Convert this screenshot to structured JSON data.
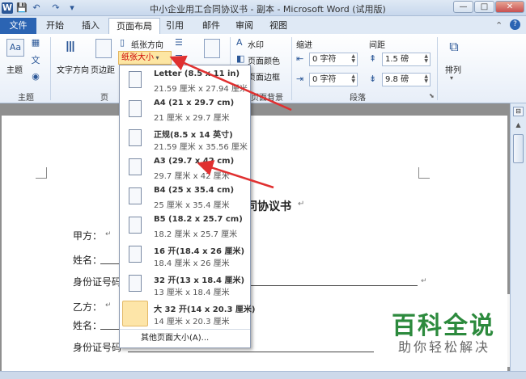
{
  "window": {
    "logo": "W",
    "title": "中小企业用工合同协议书 - 副本 - Microsoft Word (试用版)",
    "controls": {
      "minimize": "—",
      "maximize": "□",
      "close": "✕"
    }
  },
  "tabs": [
    "文件",
    "开始",
    "插入",
    "页面布局",
    "引用",
    "邮件",
    "审阅",
    "视图"
  ],
  "ribbon": {
    "theme_group": {
      "label": "主题",
      "button": "主题"
    },
    "page_setup": {
      "orientation": "纸张方向",
      "paper_size": "纸张大小",
      "text_direction": "文字方向",
      "margins": "页边距",
      "group_label": "页",
      "partial_text": "稿纸"
    },
    "page_bg": {
      "watermark": "水印",
      "page_color": "页面颜色",
      "page_border": "页面边框",
      "group_label": "页面背景"
    },
    "paragraph": {
      "indent_label": "缩进",
      "spacing_label": "间距",
      "indent_left": "0 字符",
      "indent_right": "0 字符",
      "spacing_before": "1.5 磅",
      "spacing_after": "9.8 磅",
      "group_label": "段落"
    },
    "arrange": {
      "label": "排列"
    }
  },
  "paper_sizes": [
    {
      "title": "Letter (8.5 x 11 in)",
      "dims": "21.59 厘米 x 27.94 厘米"
    },
    {
      "title": "A4 (21 x 29.7 cm)",
      "dims": "21 厘米 x 29.7 厘米"
    },
    {
      "title": "正规(8.5 x 14 英寸)",
      "dims": "21.59 厘米 x 35.56 厘米"
    },
    {
      "title": "A3 (29.7 x 42 cm)",
      "dims": "29.7 厘米 x 42 厘米"
    },
    {
      "title": "B4 (25 x 35.4 cm)",
      "dims": "25 厘米 x 35.4 厘米"
    },
    {
      "title": "B5 (18.2 x 25.7 cm)",
      "dims": "18.2 厘米 x 25.7 厘米"
    },
    {
      "title": "16 开(18.4 x 26 厘米)",
      "dims": "18.4 厘米 x 26 厘米"
    },
    {
      "title": "32 开(13 x 18.4 厘米)",
      "dims": "13 厘米 x 18.4 厘米"
    },
    {
      "title": "大 32 开(14 x 20.3 厘米)",
      "dims": "14 厘米 x 20.3 厘米"
    }
  ],
  "more_sizes": "其他页面大小(A)...",
  "document": {
    "heading": "同协议书",
    "lines": [
      "甲方：",
      "姓名：",
      "身份证号码",
      "乙方：",
      "姓名：",
      "身份证号码"
    ]
  },
  "watermark": {
    "title": "百科全说",
    "subtitle": "助你轻松解决"
  },
  "colors": {
    "accent": "#2b64b3",
    "highlight": "#fde6a3",
    "arrow": "#e03030",
    "watermark_green": "#2c8a3d"
  }
}
